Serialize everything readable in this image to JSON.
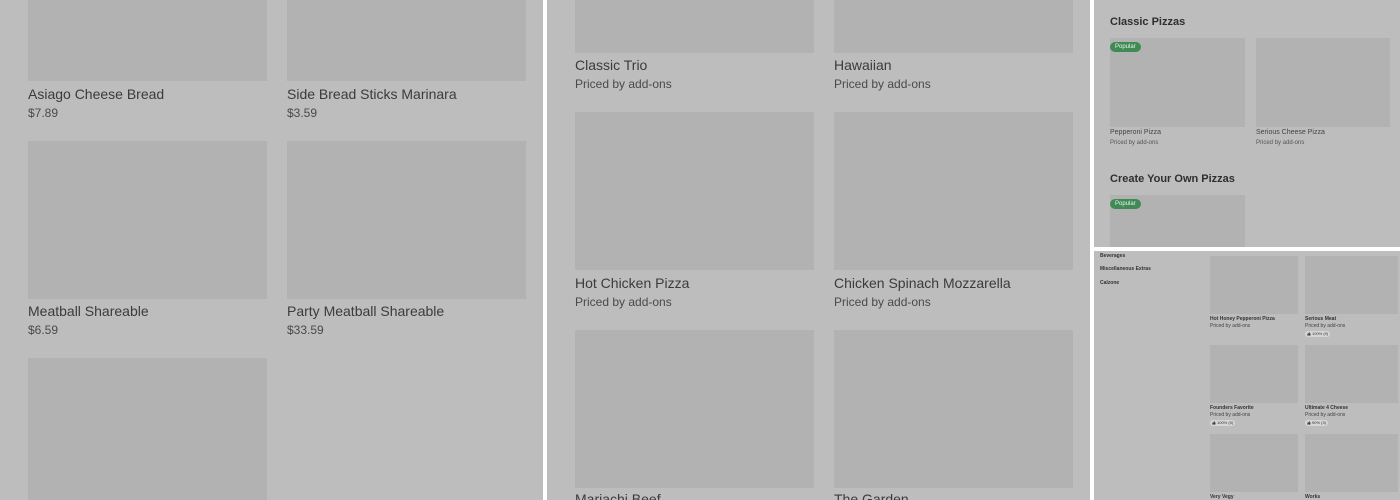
{
  "panel1": {
    "items": [
      {
        "name": "Asiago Cheese Bread",
        "price": "$7.89"
      },
      {
        "name": "Side Bread Sticks Marinara",
        "price": "$3.59"
      },
      {
        "name": "Meatball Shareable",
        "price": "$6.59"
      },
      {
        "name": "Party Meatball Shareable",
        "price": "$33.59"
      }
    ]
  },
  "panel2": {
    "items": [
      {
        "name": "Classic Trio",
        "price": "Priced by add-ons"
      },
      {
        "name": "Hawaiian",
        "price": "Priced by add-ons"
      },
      {
        "name": "Hot Chicken Pizza",
        "price": "Priced by add-ons"
      },
      {
        "name": "Chicken Spinach Mozzarella",
        "price": "Priced by add-ons"
      },
      {
        "name": "Mariachi Beef",
        "price": ""
      },
      {
        "name": "The Garden",
        "price": ""
      }
    ]
  },
  "panel3": {
    "section1_title": "Classic Pizzas",
    "section2_title": "Create Your Own Pizzas",
    "badge": "Popular",
    "items": [
      {
        "name": "Pepperoni Pizza",
        "price": "Priced by add-ons"
      },
      {
        "name": "Serious Cheese Pizza",
        "price": "Priced by add-ons"
      }
    ]
  },
  "panel4": {
    "sidebar": [
      "Beverages",
      "Miscellaneous Extras",
      "Calzone"
    ],
    "items": [
      {
        "name": "Hot Honey Pepperoni Pizza",
        "price": "Priced by add-ons",
        "rating": ""
      },
      {
        "name": "Serious Meat",
        "price": "Priced by add-ons",
        "rating": "100% (9)"
      },
      {
        "name": "Founders Favorite",
        "price": "Priced by add-ons",
        "rating": "100% (5)"
      },
      {
        "name": "Ultimate 4 Cheese",
        "price": "Priced by add-ons",
        "rating": "90% (3)"
      },
      {
        "name": "Very Vegy",
        "price": "",
        "rating": ""
      },
      {
        "name": "Works",
        "price": "",
        "rating": ""
      }
    ]
  },
  "colors": {
    "panel_bg": "#bdbdbd",
    "image_placeholder": "#b2b2b2",
    "badge_green": "#3f8a55",
    "divider": "#ffffff"
  }
}
